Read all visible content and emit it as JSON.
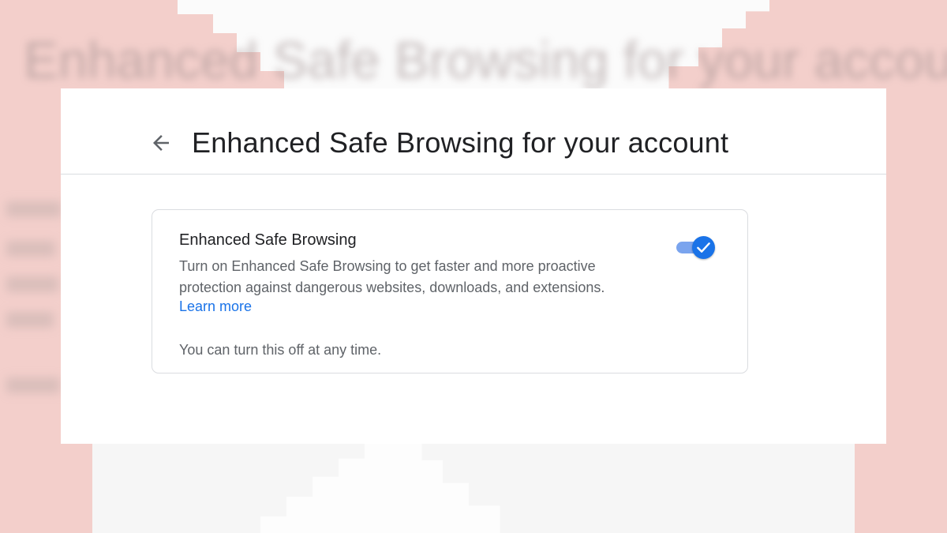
{
  "page": {
    "title": "Enhanced Safe Browsing for your account",
    "background_title": "Enhanced Safe Browsing for your account"
  },
  "header": {
    "back_icon": "arrow-left-icon",
    "title": "Enhanced Safe Browsing for your account"
  },
  "setting": {
    "title": "Enhanced Safe Browsing",
    "description": "Turn on Enhanced Safe Browsing to get faster and more proactive protection against dangerous websites, downloads, and extensions.",
    "learn_more": "Learn more",
    "footnote": "You can turn this off at any time.",
    "toggle_on": true,
    "toggle_icon": "checkmark-icon"
  },
  "colors": {
    "accent": "#1a73e8",
    "accent_track": "#7aa4ee",
    "background": "#f3cfcb",
    "title_text": "#202124",
    "secondary_text": "#5f6368",
    "divider": "#dadce0"
  }
}
